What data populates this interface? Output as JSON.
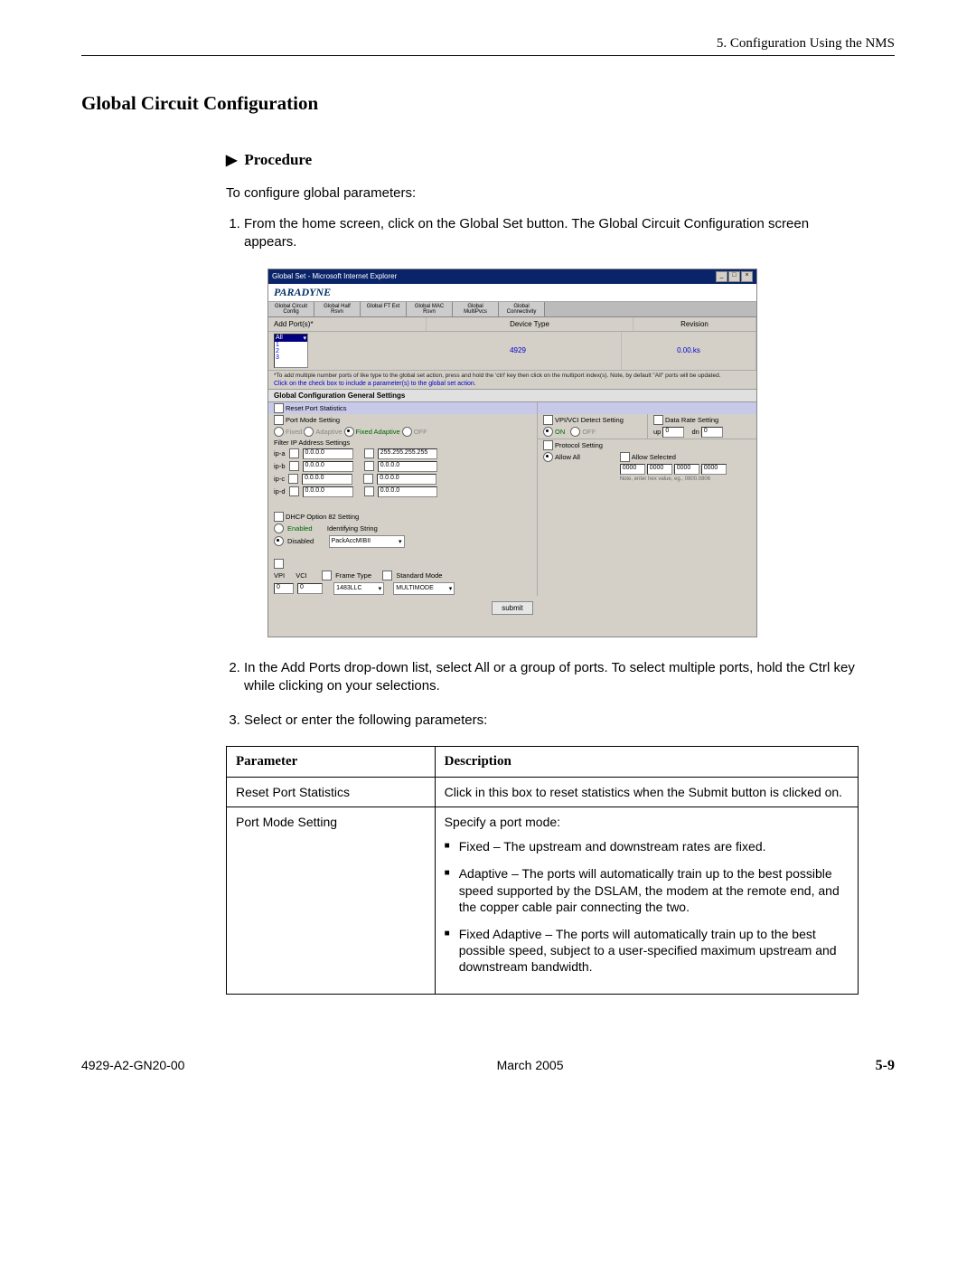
{
  "header": {
    "chapter": "5. Configuration Using the NMS"
  },
  "section_title": "Global Circuit Configuration",
  "procedure": {
    "heading": "Procedure",
    "intro": "To configure global parameters:",
    "step1": "From the home screen, click on the Global Set button. The Global Circuit Configuration screen appears.",
    "step2": "In the Add Ports drop-down list, select All or a group of ports. To select multiple ports, hold the Ctrl key while clicking on your selections.",
    "step3": "Select or enter the following parameters:"
  },
  "screenshot": {
    "title": "Global Set - Microsoft Internet Explorer",
    "logo": "PARADYNE",
    "tabs": [
      "Global\nCircuit Config",
      "Global\nHalf Rsvn",
      "Global\nFT Ext",
      "Global\nMAC Rsvn",
      "Global\nMultiPvcs",
      "Global\nConnectivity"
    ],
    "head_addports": "Add Port(s)*",
    "head_devtype": "Device Type",
    "head_rev": "Revision",
    "dev_value": "4929",
    "rev_value": "0.00.ks",
    "port_all": "All",
    "note1": "*To add multiple number ports of like type to the global set action, press and hold the 'ctrl' key then click on the multiport index(s). Note, by default \"All\" ports will be updated.",
    "note2": "Click on the check box to include a parameter(s) to the global set action.",
    "subhead": "Global Configuration General Settings",
    "reset_port": "Reset Port Statistics",
    "port_mode": "Port Mode Setting",
    "mode_fixed": "Fixed",
    "mode_adaptive": "Adaptive",
    "mode_fixedadapt": "Fixed Adaptive",
    "mode_off": "OFF",
    "filter_ip": "Filter IP Address Settings",
    "ip_labels": [
      "ip-a",
      "ip-b",
      "ip-c",
      "ip-d"
    ],
    "ip_zero": "0.0.0.0",
    "ip_mask": "255.255.255.255",
    "dhcp82": "DHCP Option 82 Setting",
    "dhcp_enabled": "Enabled",
    "dhcp_disabled": "Disabled",
    "ident_str": "Identifying String",
    "ident_val": "PackAccMIBII",
    "vpi": "VPI",
    "vci": "VCI",
    "frame_type": "Frame Type",
    "std_mode": "Standard Mode",
    "vpi_val": "0",
    "vci_val": "0",
    "frame_val": "1483LLC",
    "mode_val": "MULTIMODE",
    "vpivci_detect": "VPI/VCI Detect Setting",
    "on": "ON",
    "off": "OFF",
    "protocol": "Protocol Setting",
    "allow_all": "Allow All",
    "allow_sel": "Allow Selected",
    "proto_boxes": [
      "0000",
      "0000",
      "0000",
      "0000"
    ],
    "proto_note": "Note, enter hex value, eg., 0800.0806",
    "data_rate": "Data Rate Setting",
    "dr_up": "up",
    "dr_dn": "dn",
    "dr_val": "0",
    "submit": "submit"
  },
  "table": {
    "h1": "Parameter",
    "h2": "Description",
    "r1p": "Reset Port Statistics",
    "r1d": "Click in this box to reset statistics when the Submit button is clicked on.",
    "r2p": "Port Mode Setting",
    "r2d_intro": "Specify a port mode:",
    "r2b1": "Fixed – The upstream and downstream rates are fixed.",
    "r2b2": "Adaptive – The ports will automatically train up to the best possible speed supported by the DSLAM, the modem at the remote end, and the copper cable pair connecting the two.",
    "r2b3": "Fixed Adaptive – The ports will automatically train up to the best possible speed, subject to a user-specified maximum upstream and downstream bandwidth."
  },
  "footer": {
    "left": "4929-A2-GN20-00",
    "center": "March 2005",
    "right": "5-9"
  }
}
